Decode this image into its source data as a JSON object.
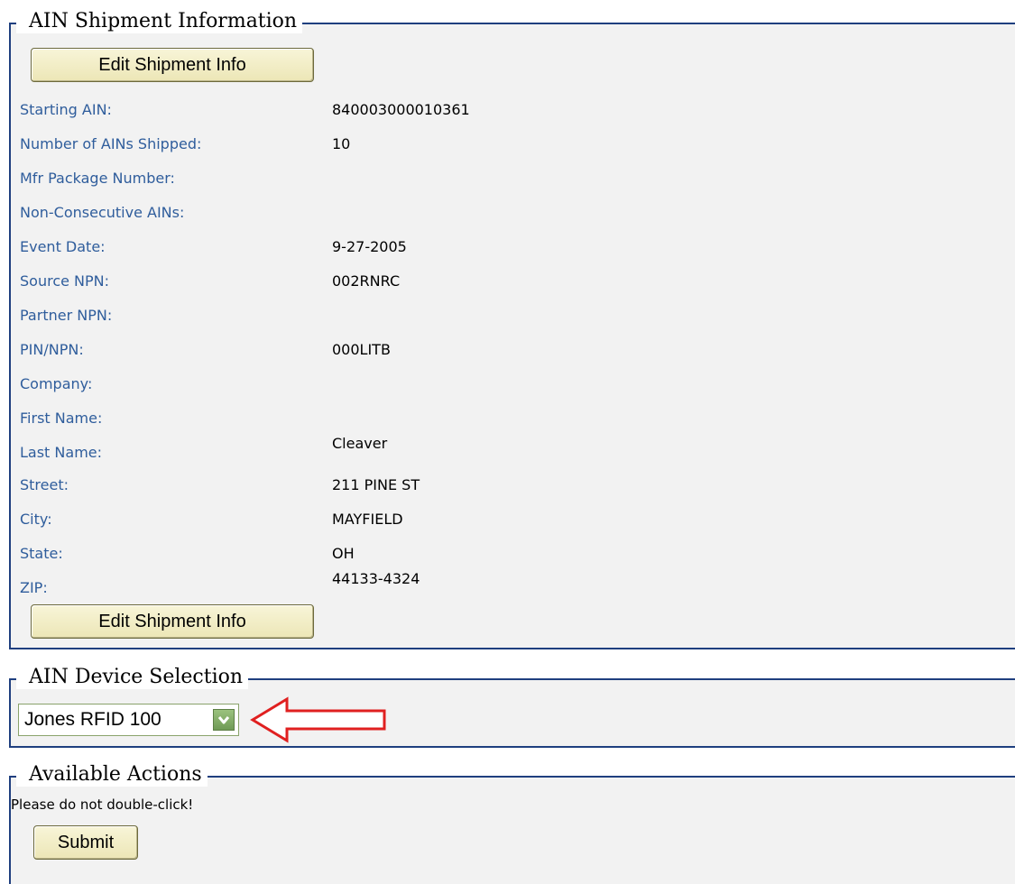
{
  "shipment": {
    "legend": "AIN Shipment Information",
    "edit_button_label": "Edit Shipment Info",
    "fields": [
      {
        "label": "Starting AIN:",
        "value": "840003000010361"
      },
      {
        "label": "Number of AINs Shipped:",
        "value": "10"
      },
      {
        "label": "Mfr Package Number:",
        "value": ""
      },
      {
        "label": "Non-Consecutive AINs:",
        "value": ""
      },
      {
        "label": "Event Date:",
        "value": "9-27-2005"
      },
      {
        "label": "Source NPN:",
        "value": "002RNRC"
      },
      {
        "label": "Partner NPN:",
        "value": ""
      },
      {
        "label": "PIN/NPN:",
        "value": "000LITB"
      },
      {
        "label": "Company:",
        "value": ""
      },
      {
        "label": "First Name:",
        "value": ""
      },
      {
        "label": "Last Name:",
        "value": "Cleaver"
      },
      {
        "label": "Street:",
        "value": "211 PINE ST"
      },
      {
        "label": "City:",
        "value": "MAYFIELD"
      },
      {
        "label": "State:",
        "value": "OH"
      },
      {
        "label": "ZIP:",
        "value": "44133-4324"
      }
    ]
  },
  "device_selection": {
    "legend": "AIN Device Selection",
    "selected_value": "Jones RFID 100",
    "annotation_color": "#e02020"
  },
  "actions": {
    "legend": "Available Actions",
    "warning": "Please do not double-click!",
    "submit_label": "Submit"
  },
  "colors": {
    "border": "#1f3f7f",
    "label": "#2f5d9c",
    "panel_bg": "#f2f2f2"
  }
}
